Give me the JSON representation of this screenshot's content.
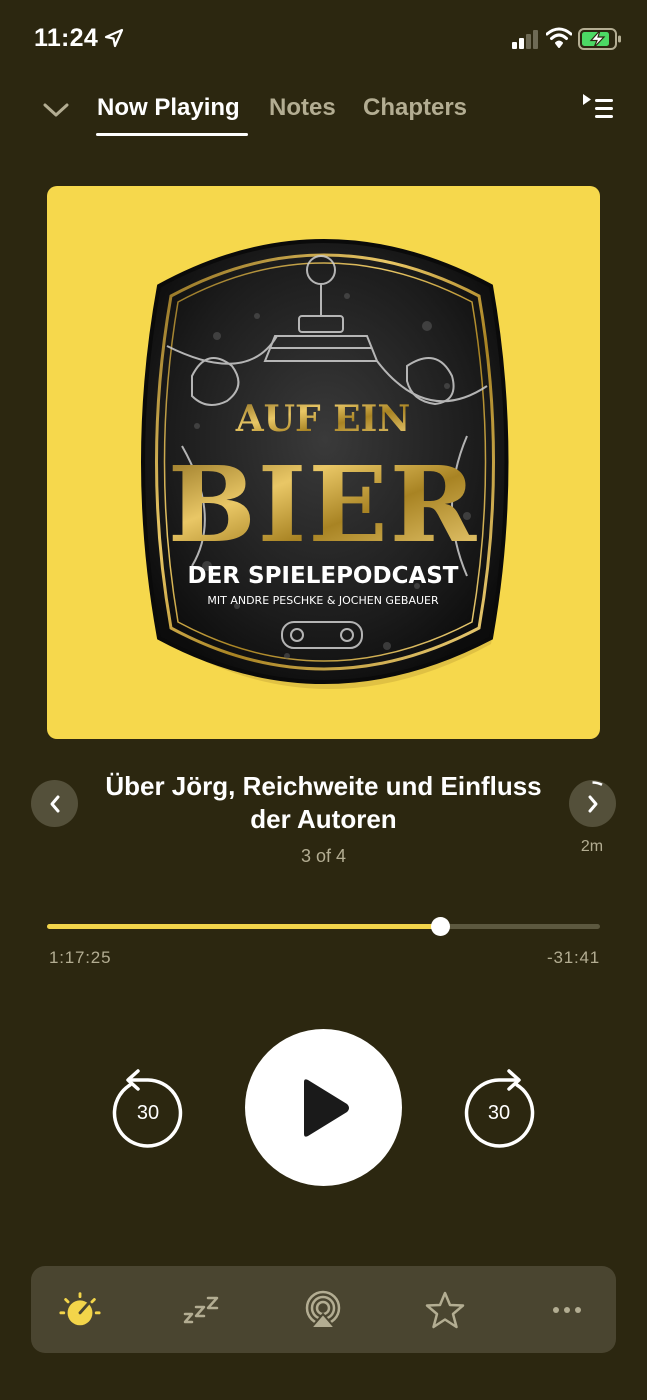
{
  "status_bar": {
    "time": "11:24",
    "icons": [
      "location-arrow-icon",
      "cellular-signal-icon",
      "wifi-icon",
      "battery-charging-icon"
    ]
  },
  "header": {
    "tabs": [
      {
        "label": "Now Playing",
        "active": true
      },
      {
        "label": "Notes",
        "active": false
      },
      {
        "label": "Chapters",
        "active": false
      }
    ],
    "collapse_icon": "chevron-down-icon",
    "upnext_icon": "up-next-queue-icon"
  },
  "artwork": {
    "background_color": "#f6d84c",
    "text_line1": "AUF EIN",
    "text_line2": "BIER",
    "text_line3": "DER SPIELEPODCAST",
    "text_line4": "MIT ANDRE PESCHKE & JOCHEN GEBAUER"
  },
  "chapter": {
    "title": "Über Jörg, Reichweite und Einfluss der Autoren",
    "count": "3 of 4",
    "next_remaining": "2m",
    "prev_icon": "chevron-left-icon",
    "next_icon": "chevron-right-icon"
  },
  "playback": {
    "elapsed": "1:17:25",
    "remaining": "-31:41",
    "progress_fraction": 0.71
  },
  "controls": {
    "skip_back_label": "30",
    "skip_forward_label": "30",
    "play_icon": "play-icon"
  },
  "toolbar": {
    "items": [
      "playback-speed-icon",
      "sleep-timer-icon",
      "airplay-icon",
      "star-icon",
      "more-icon"
    ]
  },
  "colors": {
    "background": "#2c2710",
    "accent": "#f3d54a",
    "secondary_text": "#b3ad92",
    "toolbar_bg": "#4a4530"
  }
}
